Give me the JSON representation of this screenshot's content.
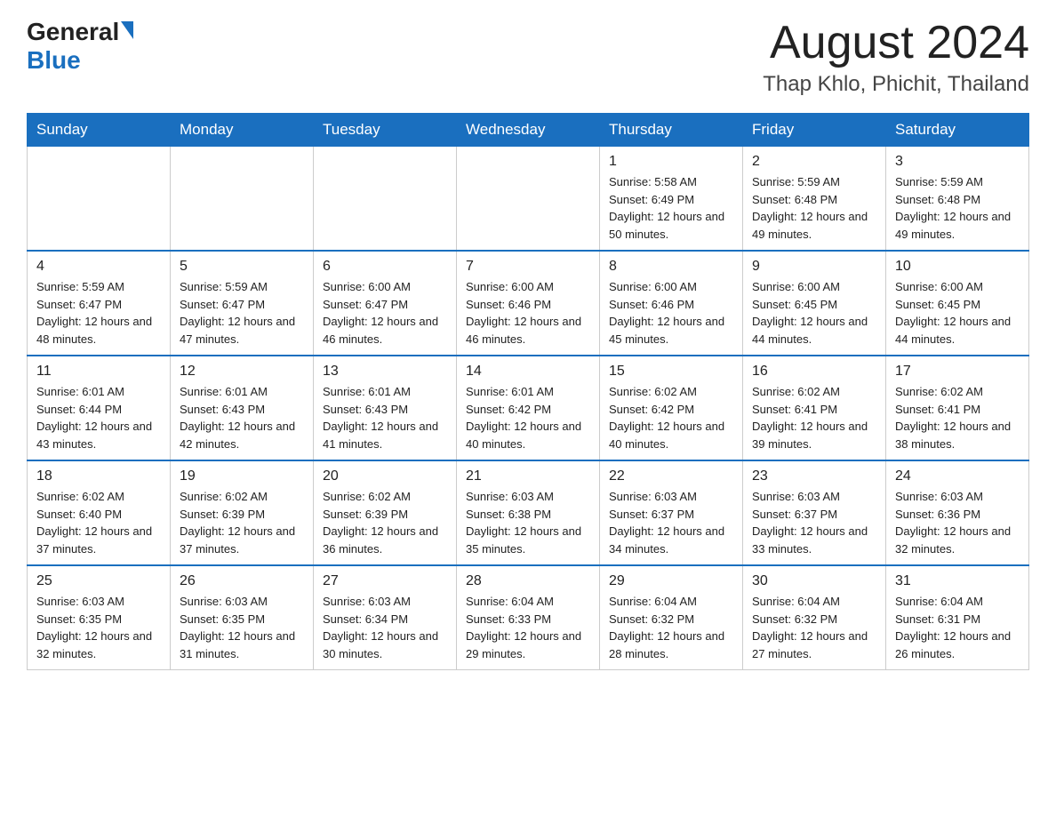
{
  "header": {
    "logo_general": "General",
    "logo_blue": "Blue",
    "month_title": "August 2024",
    "location": "Thap Khlo, Phichit, Thailand"
  },
  "days_of_week": [
    "Sunday",
    "Monday",
    "Tuesday",
    "Wednesday",
    "Thursday",
    "Friday",
    "Saturday"
  ],
  "weeks": [
    [
      {
        "day": "",
        "info": ""
      },
      {
        "day": "",
        "info": ""
      },
      {
        "day": "",
        "info": ""
      },
      {
        "day": "",
        "info": ""
      },
      {
        "day": "1",
        "info": "Sunrise: 5:58 AM\nSunset: 6:49 PM\nDaylight: 12 hours and 50 minutes."
      },
      {
        "day": "2",
        "info": "Sunrise: 5:59 AM\nSunset: 6:48 PM\nDaylight: 12 hours and 49 minutes."
      },
      {
        "day": "3",
        "info": "Sunrise: 5:59 AM\nSunset: 6:48 PM\nDaylight: 12 hours and 49 minutes."
      }
    ],
    [
      {
        "day": "4",
        "info": "Sunrise: 5:59 AM\nSunset: 6:47 PM\nDaylight: 12 hours and 48 minutes."
      },
      {
        "day": "5",
        "info": "Sunrise: 5:59 AM\nSunset: 6:47 PM\nDaylight: 12 hours and 47 minutes."
      },
      {
        "day": "6",
        "info": "Sunrise: 6:00 AM\nSunset: 6:47 PM\nDaylight: 12 hours and 46 minutes."
      },
      {
        "day": "7",
        "info": "Sunrise: 6:00 AM\nSunset: 6:46 PM\nDaylight: 12 hours and 46 minutes."
      },
      {
        "day": "8",
        "info": "Sunrise: 6:00 AM\nSunset: 6:46 PM\nDaylight: 12 hours and 45 minutes."
      },
      {
        "day": "9",
        "info": "Sunrise: 6:00 AM\nSunset: 6:45 PM\nDaylight: 12 hours and 44 minutes."
      },
      {
        "day": "10",
        "info": "Sunrise: 6:00 AM\nSunset: 6:45 PM\nDaylight: 12 hours and 44 minutes."
      }
    ],
    [
      {
        "day": "11",
        "info": "Sunrise: 6:01 AM\nSunset: 6:44 PM\nDaylight: 12 hours and 43 minutes."
      },
      {
        "day": "12",
        "info": "Sunrise: 6:01 AM\nSunset: 6:43 PM\nDaylight: 12 hours and 42 minutes."
      },
      {
        "day": "13",
        "info": "Sunrise: 6:01 AM\nSunset: 6:43 PM\nDaylight: 12 hours and 41 minutes."
      },
      {
        "day": "14",
        "info": "Sunrise: 6:01 AM\nSunset: 6:42 PM\nDaylight: 12 hours and 40 minutes."
      },
      {
        "day": "15",
        "info": "Sunrise: 6:02 AM\nSunset: 6:42 PM\nDaylight: 12 hours and 40 minutes."
      },
      {
        "day": "16",
        "info": "Sunrise: 6:02 AM\nSunset: 6:41 PM\nDaylight: 12 hours and 39 minutes."
      },
      {
        "day": "17",
        "info": "Sunrise: 6:02 AM\nSunset: 6:41 PM\nDaylight: 12 hours and 38 minutes."
      }
    ],
    [
      {
        "day": "18",
        "info": "Sunrise: 6:02 AM\nSunset: 6:40 PM\nDaylight: 12 hours and 37 minutes."
      },
      {
        "day": "19",
        "info": "Sunrise: 6:02 AM\nSunset: 6:39 PM\nDaylight: 12 hours and 37 minutes."
      },
      {
        "day": "20",
        "info": "Sunrise: 6:02 AM\nSunset: 6:39 PM\nDaylight: 12 hours and 36 minutes."
      },
      {
        "day": "21",
        "info": "Sunrise: 6:03 AM\nSunset: 6:38 PM\nDaylight: 12 hours and 35 minutes."
      },
      {
        "day": "22",
        "info": "Sunrise: 6:03 AM\nSunset: 6:37 PM\nDaylight: 12 hours and 34 minutes."
      },
      {
        "day": "23",
        "info": "Sunrise: 6:03 AM\nSunset: 6:37 PM\nDaylight: 12 hours and 33 minutes."
      },
      {
        "day": "24",
        "info": "Sunrise: 6:03 AM\nSunset: 6:36 PM\nDaylight: 12 hours and 32 minutes."
      }
    ],
    [
      {
        "day": "25",
        "info": "Sunrise: 6:03 AM\nSunset: 6:35 PM\nDaylight: 12 hours and 32 minutes."
      },
      {
        "day": "26",
        "info": "Sunrise: 6:03 AM\nSunset: 6:35 PM\nDaylight: 12 hours and 31 minutes."
      },
      {
        "day": "27",
        "info": "Sunrise: 6:03 AM\nSunset: 6:34 PM\nDaylight: 12 hours and 30 minutes."
      },
      {
        "day": "28",
        "info": "Sunrise: 6:04 AM\nSunset: 6:33 PM\nDaylight: 12 hours and 29 minutes."
      },
      {
        "day": "29",
        "info": "Sunrise: 6:04 AM\nSunset: 6:32 PM\nDaylight: 12 hours and 28 minutes."
      },
      {
        "day": "30",
        "info": "Sunrise: 6:04 AM\nSunset: 6:32 PM\nDaylight: 12 hours and 27 minutes."
      },
      {
        "day": "31",
        "info": "Sunrise: 6:04 AM\nSunset: 6:31 PM\nDaylight: 12 hours and 26 minutes."
      }
    ]
  ]
}
